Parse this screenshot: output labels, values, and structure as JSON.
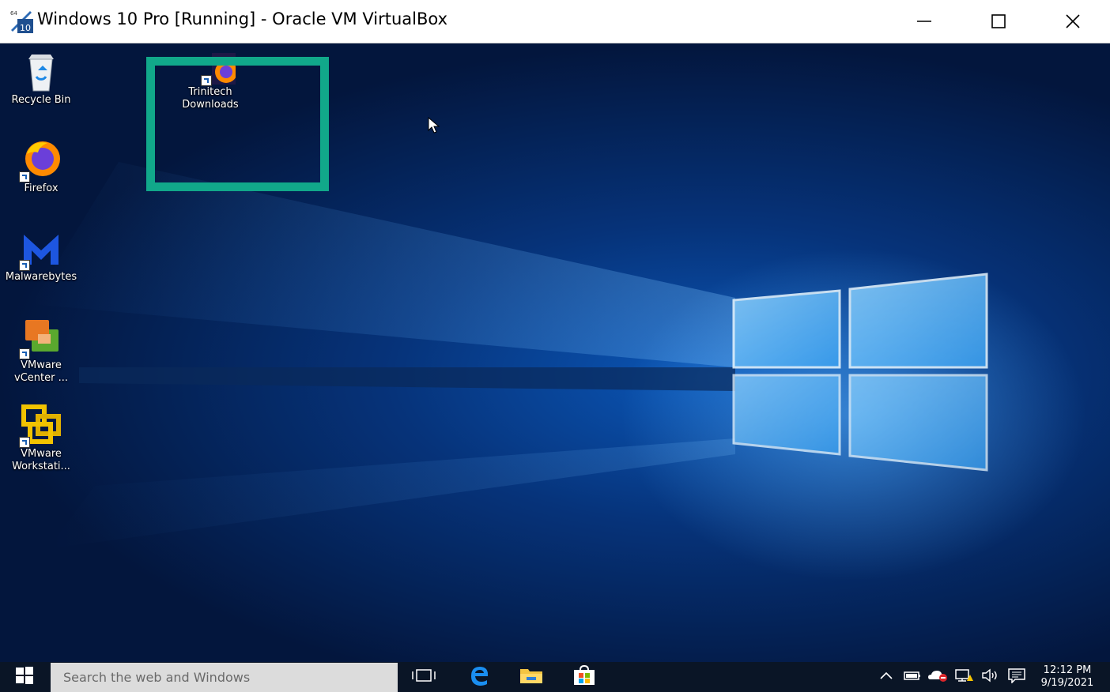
{
  "window": {
    "title": "Windows 10 Pro [Running] - Oracle VM VirtualBox",
    "controls": {
      "minimize": "minimize-icon",
      "maximize": "maximize-icon",
      "close": "close-icon"
    }
  },
  "desktop": {
    "icons": [
      {
        "label": "Recycle Bin",
        "icon": "recycle-bin-icon"
      },
      {
        "label": "Firefox",
        "icon": "firefox-icon"
      },
      {
        "label": "Malwarebytes",
        "icon": "malwarebytes-icon"
      },
      {
        "label": "VMware vCenter ...",
        "icon": "vmware-vcenter-icon"
      },
      {
        "label": "VMware Workstati...",
        "icon": "vmware-workstation-icon"
      },
      {
        "label": "Trinitech Downloads",
        "icon": "firefox-icon"
      }
    ],
    "highlight_color": "#11a88a"
  },
  "taskbar": {
    "search_placeholder": "Search the web and Windows",
    "pinned": [
      "task-view-icon",
      "edge-icon",
      "file-explorer-icon",
      "store-icon"
    ],
    "tray": [
      "chevron-up-icon",
      "battery-icon",
      "onedrive-icon",
      "network-icon",
      "volume-icon",
      "action-center-icon"
    ],
    "time": "12:12 PM",
    "date": "9/19/2021"
  }
}
